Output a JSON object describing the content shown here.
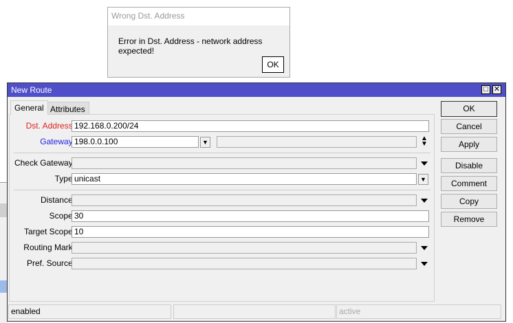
{
  "error_dialog": {
    "title": "Wrong Dst. Address",
    "message": "Error in Dst. Address - network address expected!",
    "ok_label": "OK"
  },
  "window": {
    "title": "New Route",
    "maximize_icon": "□",
    "close_icon": "✕",
    "tabs": [
      {
        "label": "General"
      },
      {
        "label": "Attributes"
      }
    ],
    "fields": {
      "dst_address": {
        "label": "Dst. Address:",
        "value": "192.168.0.200/24",
        "color": "#e02020"
      },
      "gateway": {
        "label": "Gateway:",
        "value": "198.0.0.100",
        "color": "#2020e0"
      },
      "check_gateway": {
        "label": "Check Gateway:",
        "value": ""
      },
      "type": {
        "label": "Type:",
        "value": "unicast"
      },
      "distance": {
        "label": "Distance:",
        "value": ""
      },
      "scope": {
        "label": "Scope:",
        "value": "30"
      },
      "target_scope": {
        "label": "Target Scope:",
        "value": "10"
      },
      "routing_mark": {
        "label": "Routing Mark:",
        "value": ""
      },
      "pref_source": {
        "label": "Pref. Source:",
        "value": ""
      }
    },
    "buttons": {
      "ok": "OK",
      "cancel": "Cancel",
      "apply": "Apply",
      "disable": "Disable",
      "comment": "Comment",
      "copy": "Copy",
      "remove": "Remove"
    },
    "status": {
      "left": "enabled",
      "middle": "",
      "right": "active"
    },
    "title_color": "#4f50c9"
  }
}
